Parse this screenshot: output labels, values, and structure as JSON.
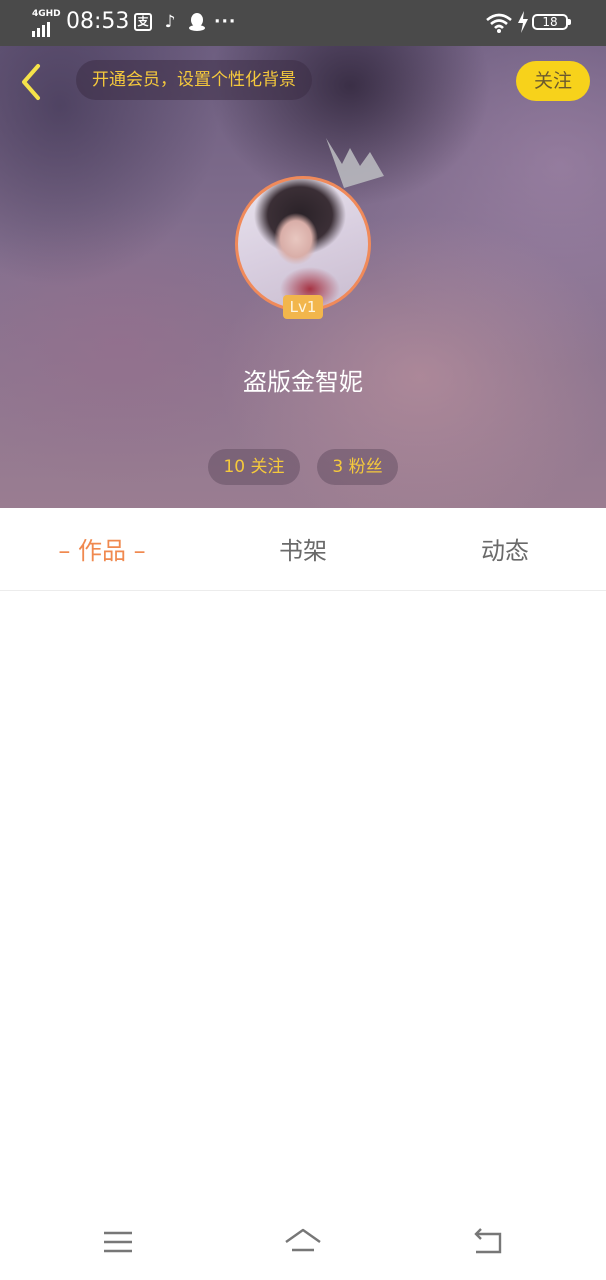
{
  "status_bar": {
    "network": "4GHD",
    "time": "08:53",
    "icons": [
      "alipay-icon",
      "tiktok-icon",
      "qq-icon",
      "more-icon"
    ],
    "alipay_glyph": "支",
    "more_glyph": "···",
    "battery": "18"
  },
  "header": {
    "back_icon": "chevron-left-icon",
    "vip_promo": "开通会员，设置个性化背景",
    "follow_label": "关注",
    "username": "盗版金智妮",
    "level": "Lv1",
    "following": "10 关注",
    "fans": "3 粉丝"
  },
  "tabs": [
    {
      "label": "– 作品 –",
      "active": true
    },
    {
      "label": "书架",
      "active": false
    },
    {
      "label": "动态",
      "active": false
    }
  ],
  "nav_bar": {
    "icons": [
      "menu-icon",
      "home-icon",
      "back-icon"
    ]
  },
  "colors": {
    "accent": "#f0894f",
    "gold": "#f5c93c",
    "follow_button": "#f7d21b",
    "status_bar": "#4a4a4a"
  }
}
